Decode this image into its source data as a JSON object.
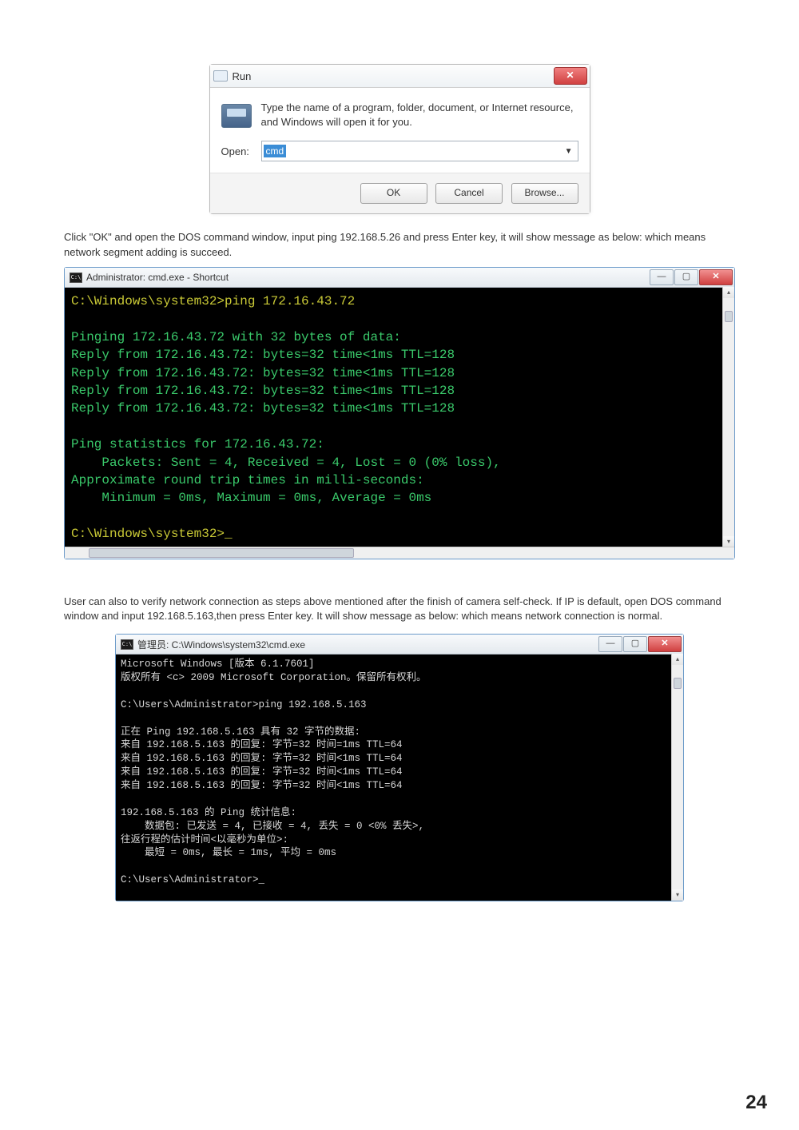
{
  "run_dialog": {
    "title": "Run",
    "desc": "Type the name of a program, folder, document, or Internet resource, and Windows will open it for you.",
    "open_label": "Open:",
    "open_value": "cmd",
    "ok": "OK",
    "cancel": "Cancel",
    "browse": "Browse...",
    "close_x": "✕"
  },
  "para1": "Click \"OK\" and open the DOS command window, input ping 192.168.5.26 and press Enter key, it will show message as below: which means network segment adding is succeed.",
  "cmd1": {
    "title": "Administrator: cmd.exe - Shortcut",
    "min": "—",
    "max": "▢",
    "close": "✕",
    "lines": [
      {
        "cls": "y",
        "t": "C:\\Windows\\system32>ping 172.16.43.72"
      },
      {
        "cls": "b",
        "t": ""
      },
      {
        "cls": "g",
        "t": "Pinging 172.16.43.72 with 32 bytes of data:"
      },
      {
        "cls": "g",
        "t": "Reply from 172.16.43.72: bytes=32 time<1ms TTL=128"
      },
      {
        "cls": "g",
        "t": "Reply from 172.16.43.72: bytes=32 time<1ms TTL=128"
      },
      {
        "cls": "g",
        "t": "Reply from 172.16.43.72: bytes=32 time<1ms TTL=128"
      },
      {
        "cls": "g",
        "t": "Reply from 172.16.43.72: bytes=32 time<1ms TTL=128"
      },
      {
        "cls": "b",
        "t": ""
      },
      {
        "cls": "g",
        "t": "Ping statistics for 172.16.43.72:"
      },
      {
        "cls": "g",
        "t": "    Packets: Sent = 4, Received = 4, Lost = 0 (0% loss),"
      },
      {
        "cls": "g",
        "t": "Approximate round trip times in milli-seconds:"
      },
      {
        "cls": "g",
        "t": "    Minimum = 0ms, Maximum = 0ms, Average = 0ms"
      },
      {
        "cls": "b",
        "t": ""
      },
      {
        "cls": "y",
        "t": "C:\\Windows\\system32>_"
      }
    ]
  },
  "para2": "User can also to verify network connection as steps above mentioned after the finish of camera self-check. If IP is default, open DOS command window and input 192.168.5.163,then press Enter key. It will show message as below: which means network connection is normal.",
  "cmd2": {
    "title": "管理员: C:\\Windows\\system32\\cmd.exe",
    "min": "—",
    "max": "▢",
    "close": "✕",
    "lines": [
      "Microsoft Windows [版本 6.1.7601]",
      "版权所有 <c> 2009 Microsoft Corporation。保留所有权利。",
      "",
      "C:\\Users\\Administrator>ping 192.168.5.163",
      "",
      "正在 Ping 192.168.5.163 具有 32 字节的数据:",
      "来自 192.168.5.163 的回复: 字节=32 时间=1ms TTL=64",
      "来自 192.168.5.163 的回复: 字节=32 时间<1ms TTL=64",
      "来自 192.168.5.163 的回复: 字节=32 时间<1ms TTL=64",
      "来自 192.168.5.163 的回复: 字节=32 时间<1ms TTL=64",
      "",
      "192.168.5.163 的 Ping 统计信息:",
      "    数据包: 已发送 = 4, 已接收 = 4, 丢失 = 0 <0% 丢失>,",
      "往返行程的估计时间<以毫秒为单位>:",
      "    最短 = 0ms, 最长 = 1ms, 平均 = 0ms",
      "",
      "C:\\Users\\Administrator>_"
    ]
  },
  "page_number": "24"
}
